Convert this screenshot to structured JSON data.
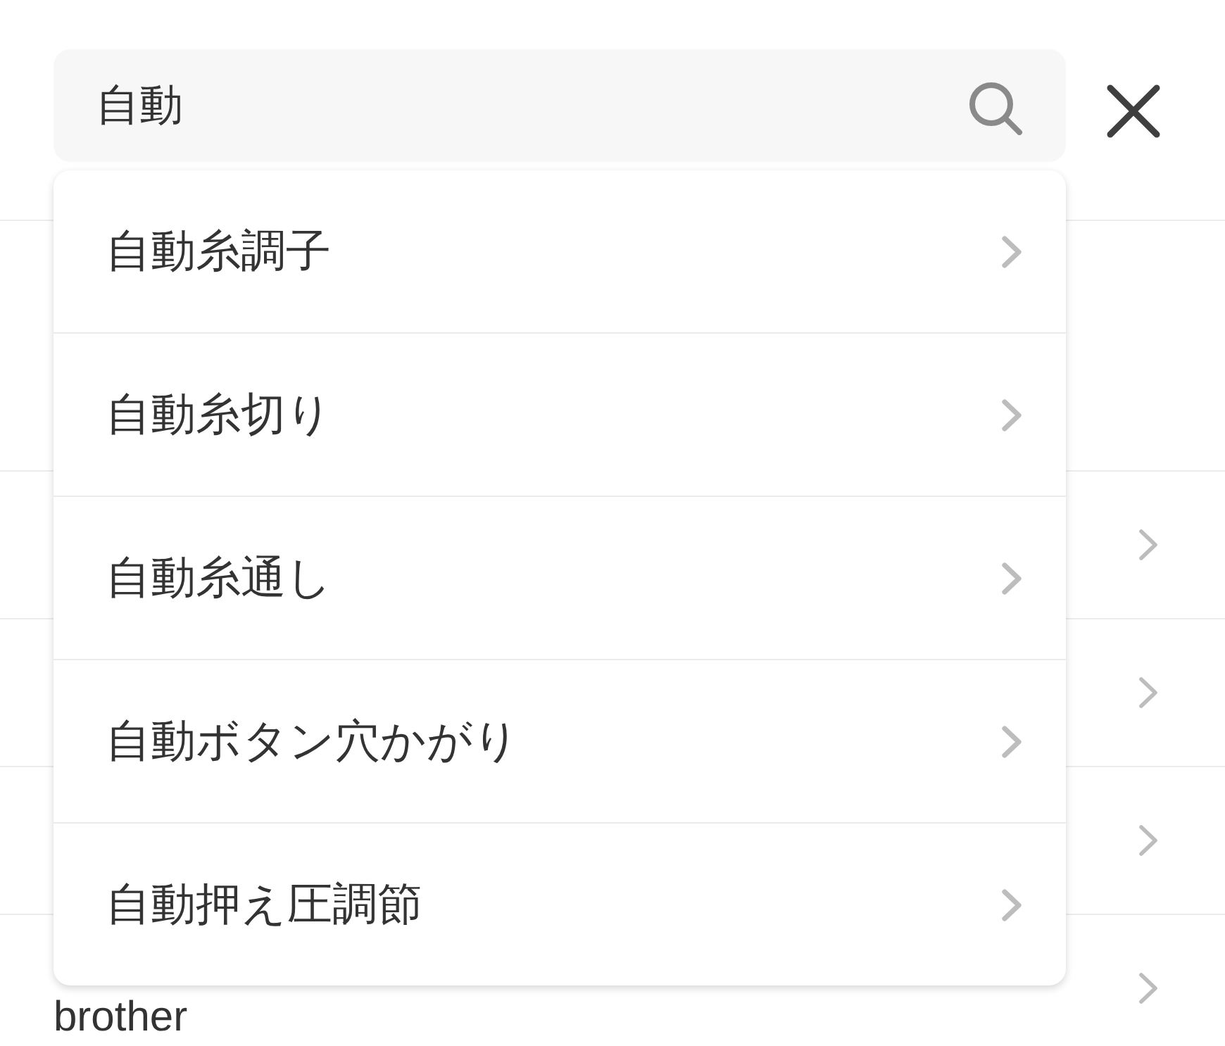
{
  "search": {
    "value": "自動"
  },
  "suggestions": [
    {
      "label": "自動糸調子"
    },
    {
      "label": "自動糸切り"
    },
    {
      "label": "自動糸通し"
    },
    {
      "label": "自動ボタン穴かがり"
    },
    {
      "label": "自動押え圧調節"
    }
  ],
  "list": {
    "rows": [
      {
        "kind": "blank"
      },
      {
        "kind": "link"
      },
      {
        "kind": "link"
      },
      {
        "kind": "link"
      },
      {
        "kind": "link",
        "label": "brother"
      }
    ]
  }
}
